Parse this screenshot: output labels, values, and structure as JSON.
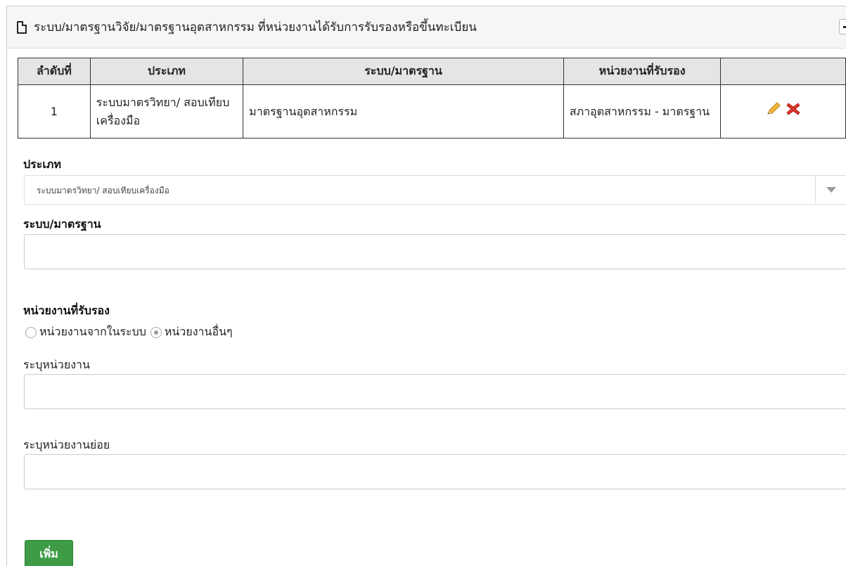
{
  "panel": {
    "title": "ระบบ/มาตรฐานวิจัย/มาตรฐานอุตสาหกรรม ที่หน่วยงานได้รับการรับรองหรือขึ้นทะเบียน"
  },
  "table": {
    "headers": [
      "ลำดับที่",
      "ประเภท",
      "ระบบ/มาตรฐาน",
      "หน่วยงานที่รับรอง",
      ""
    ],
    "rows": [
      {
        "no": "1",
        "type": "ระบบมาตรวิทยา/ สอบเทียบเครื่องมือ",
        "standard": "มาตรฐานอุตสาหกรรม",
        "agency": "สภาอุตสาหกรรม - มาตรฐาน"
      }
    ]
  },
  "form": {
    "type_label": "ประเภท",
    "type_selected": "ระบบมาตรวิทยา/ สอบเทียบเครื่องมือ",
    "standard_label": "ระบบ/มาตรฐาน",
    "standard_value": "",
    "agency_label": "หน่วยงานที่รับรอง",
    "radio_internal": "หน่วยงานจากในระบบ",
    "radio_other": "หน่วยงานอื่นๆ",
    "radio_selected": "other",
    "specify_agency_label": "ระบุหน่วยงาน",
    "specify_agency_value": "",
    "specify_subagency_label": "ระบุหน่วยงานย่อย",
    "specify_subagency_value": "",
    "add_button": "เพิ่ม"
  },
  "colors": {
    "add_button": "#3f9c46",
    "edit_icon": "#f0a830",
    "delete_icon": "#d9342b",
    "header_bg": "#e5e5e5"
  },
  "icons": [
    "document-icon",
    "collapse-icon",
    "pencil-icon",
    "delete-icon",
    "dropdown-arrow-icon"
  ]
}
